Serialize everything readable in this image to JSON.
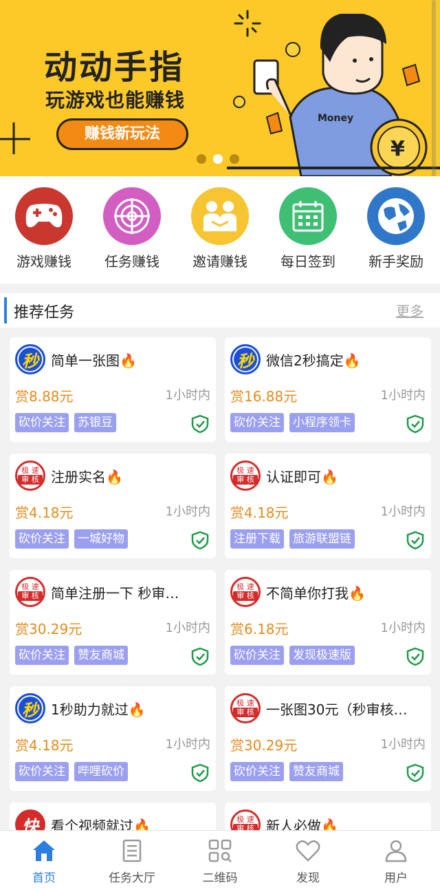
{
  "banner": {
    "title": "动动手指",
    "subtitle": "玩游戏也能赚钱",
    "pill": "赚钱新玩法",
    "shirt_text": "Money",
    "slide_count": 3,
    "active_slide": 1
  },
  "categories": [
    {
      "label": "游戏赚钱",
      "color": "#c9372f",
      "icon": "gamepad-icon"
    },
    {
      "label": "任务赚钱",
      "color": "#d35ec2",
      "icon": "target-icon"
    },
    {
      "label": "邀请赚钱",
      "color": "#f6c531",
      "icon": "people-icon"
    },
    {
      "label": "每日签到",
      "color": "#3fbf73",
      "icon": "calendar-icon"
    },
    {
      "label": "新手奖励",
      "color": "#2f77c8",
      "icon": "globe-icon"
    }
  ],
  "section": {
    "title": "推荐任务",
    "more": "更多"
  },
  "tasks": [
    {
      "icon": "秒",
      "icon_type": "miao",
      "title": "简单一张图🔥",
      "reward": "赏8.88元",
      "time": "1小时内",
      "tags": [
        "砍价关注",
        "苏银豆"
      ]
    },
    {
      "icon": "秒",
      "icon_type": "miao",
      "title": "微信2秒搞定🔥",
      "reward": "赏16.88元",
      "time": "1小时内",
      "tags": [
        "砍价关注",
        "小程序领卡"
      ]
    },
    {
      "icon_top": "极 速",
      "icon_bot": "审 核",
      "icon_type": "jisu",
      "title": "注册实名🔥",
      "reward": "赏4.18元",
      "time": "1小时内",
      "tags": [
        "砍价关注",
        "一城好物"
      ]
    },
    {
      "icon_top": "极 速",
      "icon_bot": "审 核",
      "icon_type": "jisu",
      "title": "认证即可🔥",
      "reward": "赏4.18元",
      "time": "1小时内",
      "tags": [
        "注册下载",
        "旅游联盟链"
      ]
    },
    {
      "icon_top": "极 速",
      "icon_bot": "审 核",
      "icon_type": "jisu",
      "title": "简单注册一下 秒审…",
      "reward": "赏30.29元",
      "time": "1小时内",
      "tags": [
        "砍价关注",
        "赞友商城"
      ]
    },
    {
      "icon_top": "极 速",
      "icon_bot": "审 核",
      "icon_type": "jisu",
      "title": "不简单你打我🔥",
      "reward": "赏6.18元",
      "time": "1小时内",
      "tags": [
        "砍价关注",
        "发现极速版"
      ]
    },
    {
      "icon": "秒",
      "icon_type": "miao",
      "title": "1秒助力就过🔥",
      "reward": "赏4.18元",
      "time": "1小时内",
      "tags": [
        "砍价关注",
        "哔哩砍价"
      ]
    },
    {
      "icon_top": "极 速",
      "icon_bot": "审 核",
      "icon_type": "jisu",
      "title": "一张图30元（秒审核…",
      "reward": "赏30.29元",
      "time": "1小时内",
      "tags": [
        "砍价关注",
        "赞友商城"
      ]
    },
    {
      "icon": "快",
      "icon_type": "kuai",
      "title": "看个视频就过🔥",
      "reward": "",
      "time": "",
      "tags": []
    },
    {
      "icon_top": "极 速",
      "icon_bot": "审 核",
      "icon_type": "jisu",
      "title": "新人必做🔥",
      "reward": "",
      "time": "",
      "tags": []
    }
  ],
  "nav": [
    {
      "label": "首页",
      "icon": "home-icon",
      "active": true
    },
    {
      "label": "任务大厅",
      "icon": "list-icon",
      "active": false
    },
    {
      "label": "二维码",
      "icon": "qrcode-icon",
      "active": false
    },
    {
      "label": "发现",
      "icon": "heart-icon",
      "active": false
    },
    {
      "label": "用户",
      "icon": "user-icon",
      "active": false
    }
  ],
  "colors": {
    "accent": "#2c7fe0",
    "reward": "#e58a1a",
    "tag": "#9b9ff0",
    "banner": "#fcc928",
    "verified": "#1f9a4b"
  }
}
